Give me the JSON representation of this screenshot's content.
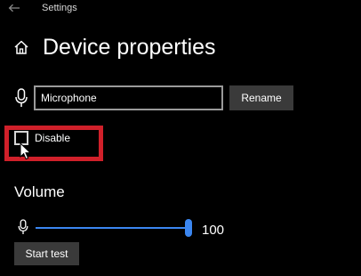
{
  "window": {
    "title": "Settings",
    "back_icon": "back-arrow-icon"
  },
  "header": {
    "icon": "home-icon",
    "title": "Device properties"
  },
  "device_name": {
    "icon": "microphone-icon",
    "value": "Microphone",
    "rename_label": "Rename"
  },
  "disable": {
    "label": "Disable",
    "checked": false,
    "highlight_color": "#d0202a"
  },
  "volume": {
    "heading": "Volume",
    "icon": "microphone-icon",
    "level": 100,
    "max": 100,
    "value_text": "100",
    "accent_color": "#3b86f0"
  },
  "test": {
    "start_label": "Start test"
  }
}
